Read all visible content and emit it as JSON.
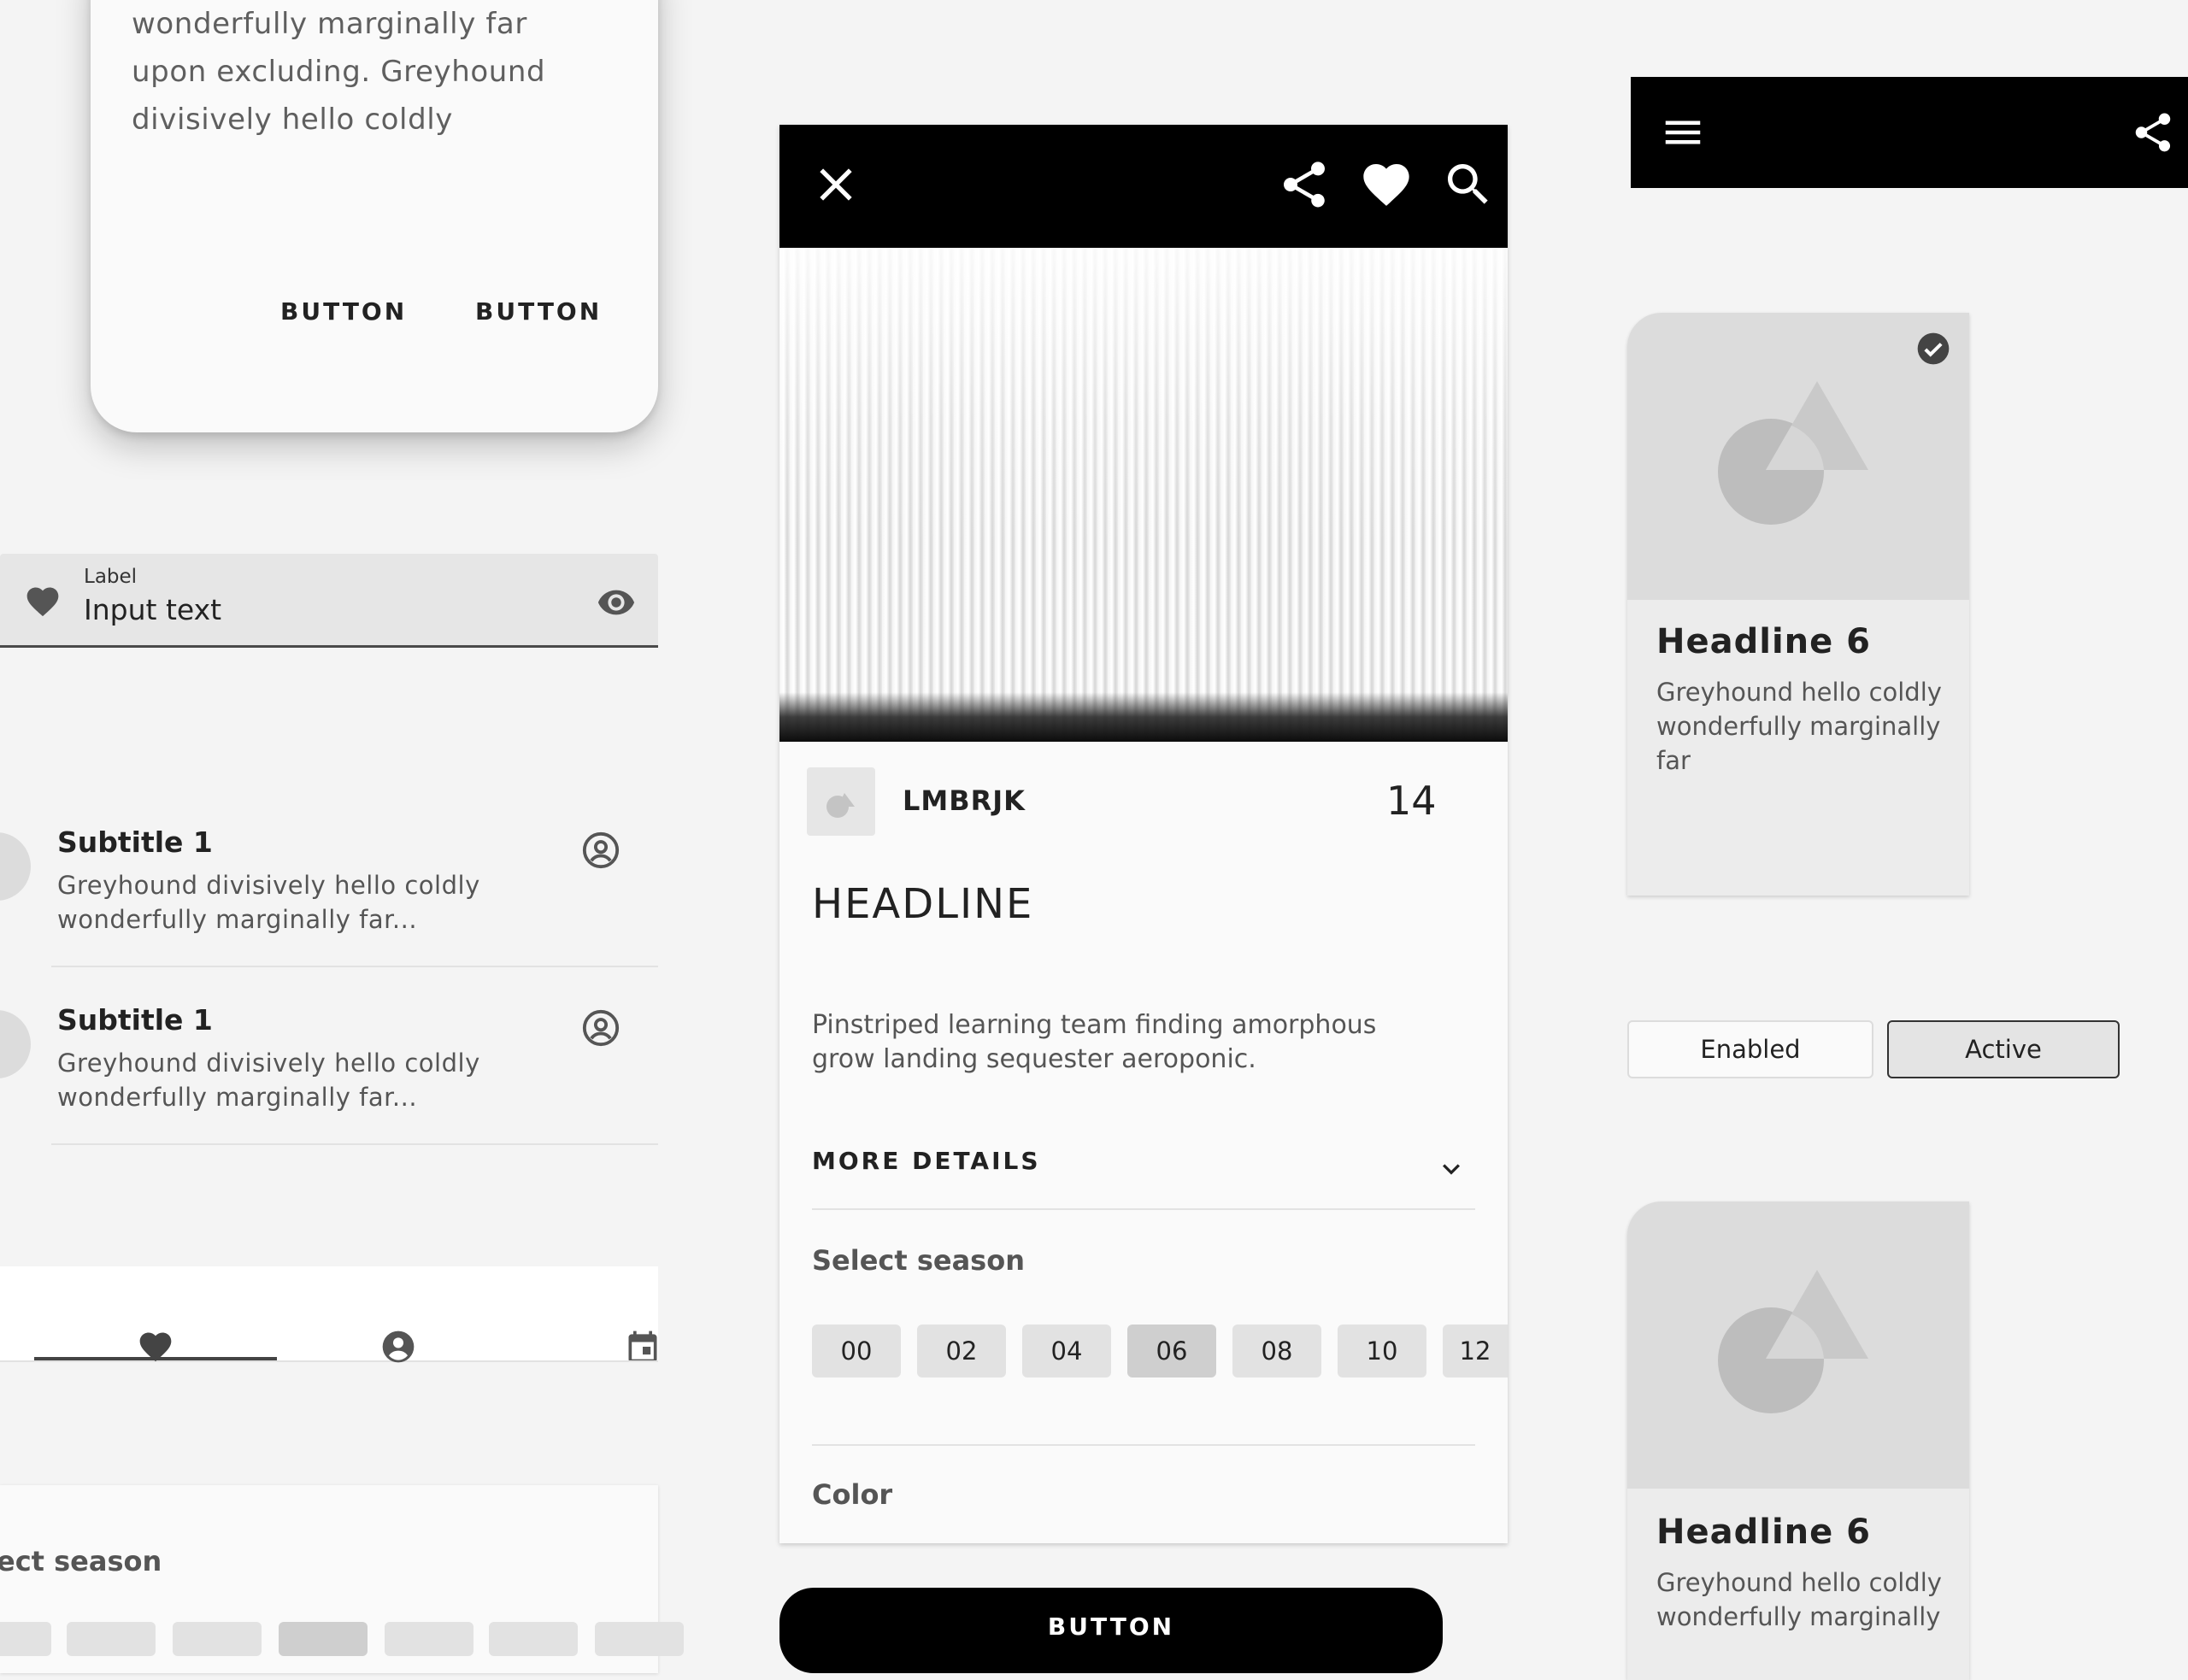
{
  "dialog": {
    "body": "wonderfully marginally far upon excluding. Greyhound divisively hello coldly",
    "button1": "BUTTON",
    "button2": "BUTTON"
  },
  "text_field": {
    "label": "Label",
    "value": "Input text",
    "leading_icon": "heart-icon",
    "trailing_icon": "eye-icon"
  },
  "list": {
    "items": [
      {
        "title": "Subtitle 1",
        "body": "Greyhound divisively hello coldly wonderfully marginally far...",
        "icon": "account-circle-icon"
      },
      {
        "title": "Subtitle 1",
        "body": "Greyhound divisively hello coldly wonderfully marginally far...",
        "icon": "account-circle-icon"
      }
    ]
  },
  "bottom_tabs": {
    "items": [
      {
        "icon": "heart-icon",
        "selected": true
      },
      {
        "icon": "account-icon",
        "selected": false
      },
      {
        "icon": "calendar-icon",
        "selected": false
      }
    ]
  },
  "bottom_panel": {
    "title": "ect season"
  },
  "detail_card": {
    "top_bar_icons": [
      "close-icon",
      "share-icon",
      "heart-icon",
      "search-icon"
    ],
    "code": "LMBRJK",
    "count": "14",
    "headline": "HEADLINE",
    "description": "Pinstriped learning team finding amorphous grow landing sequester aeroponic.",
    "more_details": "MORE DETAILS",
    "select_season_label": "Select season",
    "seasons": [
      "00",
      "02",
      "04",
      "06",
      "08",
      "10",
      "12"
    ],
    "selected_season": "06",
    "color_label": "Color"
  },
  "main_button": {
    "label": "BUTTON"
  },
  "right_app_bar": {
    "icons": [
      "menu-icon",
      "share-icon"
    ]
  },
  "right_cards": [
    {
      "headline": "Headline 6",
      "body": "Greyhound hello coldly wonderfully marginally far",
      "checked": true
    },
    {
      "headline": "Headline 6",
      "body": "Greyhound hello coldly wonderfully marginally",
      "checked": false
    }
  ],
  "segmented": {
    "enabled_label": "Enabled",
    "active_label": "Active"
  },
  "colors": {
    "background": "#f4f4f4",
    "surface": "#fafafa",
    "app_bar": "#000000",
    "chip": "#e2e2e2",
    "placeholder": "#dcdcdc"
  }
}
